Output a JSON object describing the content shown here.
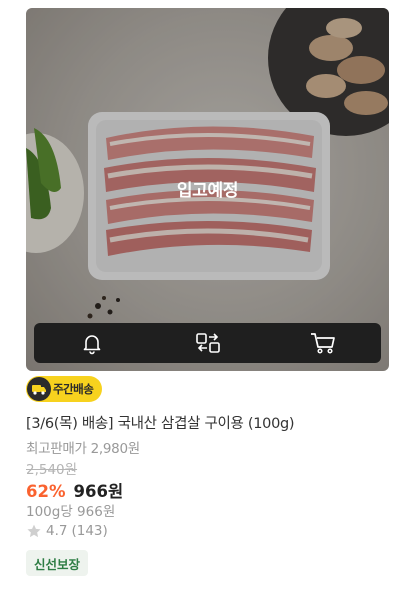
{
  "product": {
    "overlay_label": "입고예정",
    "badge_label": "주간배송",
    "title": "[3/6(목) 배송] 국내산 삼겹살 구이용 (100g)",
    "max_price_label": "최고판매가 2,980원",
    "original_price": "2,540원",
    "discount": "62%",
    "price": "966",
    "price_currency": "원",
    "unit_price": "100g당 966원",
    "rating": "4.7",
    "review_count": "(143)",
    "tag": "신선보장"
  },
  "actions": {
    "icons": [
      "bell-icon",
      "swap-icon",
      "cart-icon"
    ]
  },
  "colors": {
    "discount": "#fa622f",
    "badge_bg": "#f7d21e",
    "action_bar": "#1f1f1f",
    "tag_text": "#2e7d44"
  }
}
